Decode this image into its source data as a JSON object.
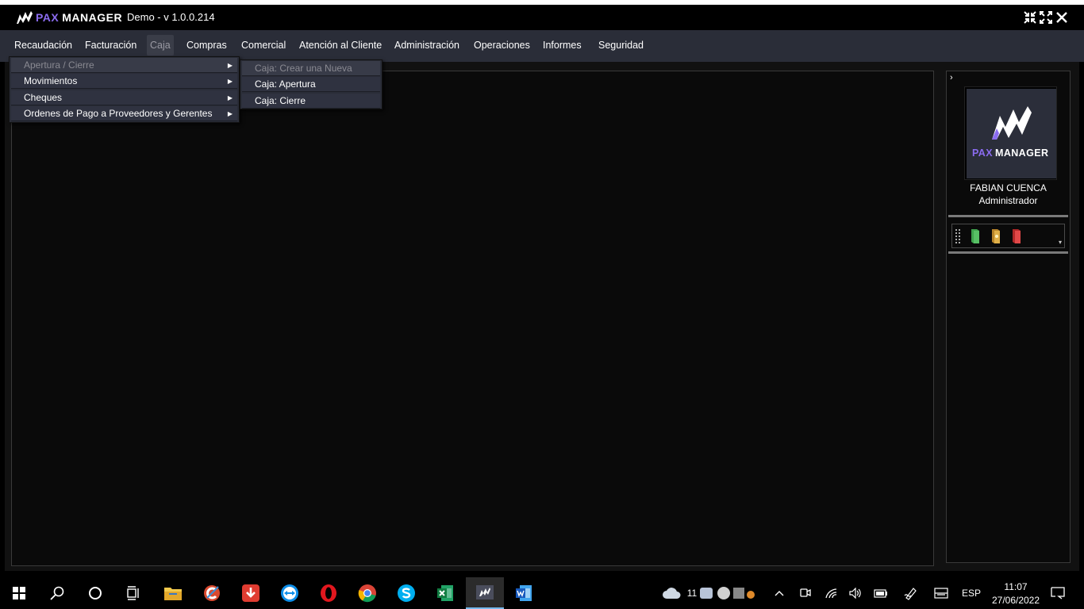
{
  "app": {
    "logo_pax": "PAX",
    "logo_manager": "MANAGER",
    "title": "Demo - v 1.0.0.214"
  },
  "menubar": {
    "items": [
      {
        "label": "Recaudación"
      },
      {
        "label": "Facturación"
      },
      {
        "label": "Caja",
        "active": true
      },
      {
        "label": "Compras"
      },
      {
        "label": "Comercial"
      },
      {
        "label": "Atención al Cliente"
      },
      {
        "label": "Administración"
      },
      {
        "label": "Operaciones"
      },
      {
        "label": "Informes"
      },
      {
        "label": "Seguridad"
      }
    ]
  },
  "caja_menu": {
    "items": [
      {
        "label": "Apertura / Cierre",
        "disabled": true,
        "has_submenu": true
      },
      {
        "label": "Movimientos",
        "has_submenu": true
      },
      {
        "label": "Cheques",
        "has_submenu": true
      },
      {
        "label": "Ordenes de Pago a Proveedores y Gerentes",
        "has_submenu": true
      }
    ]
  },
  "apertura_submenu": {
    "items": [
      {
        "label": "Caja: Crear una Nueva",
        "disabled": true
      },
      {
        "label": "Caja: Apertura"
      },
      {
        "label": "Caja: Cierre"
      }
    ]
  },
  "sidebar": {
    "avatar_pax": "PAX",
    "avatar_manager": "MANAGER",
    "user_name": "FABIAN CUENCA",
    "user_role": "Administrador",
    "tools": [
      {
        "icon": "green-book-icon",
        "color": "#3fa34d"
      },
      {
        "icon": "yellow-book-icon",
        "color": "#d8a43c"
      },
      {
        "icon": "red-book-icon",
        "color": "#d23b3b"
      }
    ]
  },
  "taskbar": {
    "weather_temp": "11",
    "language": "ESP",
    "time": "11:07",
    "date": "27/06/2022"
  },
  "colors": {
    "accent": "#8b6cf0",
    "menubar": "#2a2d38"
  }
}
